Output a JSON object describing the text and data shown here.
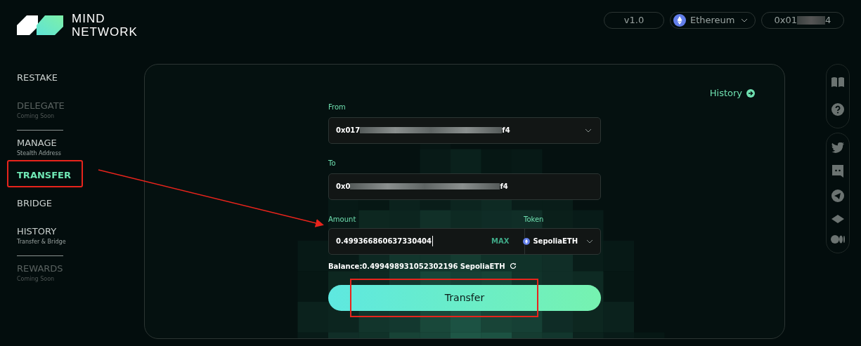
{
  "logo": {
    "line_1": "MIND",
    "line_2": "NETWORK"
  },
  "header": {
    "version": "v1.0",
    "network": "Ethereum",
    "account_start": "0x01",
    "account_end": "4"
  },
  "sidebar": {
    "items": [
      {
        "kind": "link",
        "label": "RESTAKE",
        "disabled": false,
        "selected": false
      },
      {
        "kind": "link",
        "label": "DELEGATE",
        "subtitle": "Coming Soon",
        "disabled": true,
        "selected": false
      },
      {
        "kind": "divider"
      },
      {
        "kind": "link",
        "label": "MANAGE",
        "subtitle": "Stealth Address",
        "disabled": false,
        "selected": false
      },
      {
        "kind": "link",
        "label": "TRANSFER",
        "disabled": false,
        "selected": true
      },
      {
        "kind": "link",
        "label": "BRIDGE",
        "disabled": false,
        "selected": false
      },
      {
        "kind": "link",
        "label": "HISTORY",
        "subtitle": "Transfer & Bridge",
        "disabled": false,
        "selected": false
      },
      {
        "kind": "divider"
      },
      {
        "kind": "link",
        "label": "REWARDS",
        "subtitle": "Coming Soon",
        "disabled": true,
        "selected": false
      }
    ]
  },
  "history_link": "History",
  "form": {
    "from_label": "From",
    "from_start": "0x017",
    "from_end": "f4",
    "to_label": "To",
    "to_start": "0x0",
    "to_end": "f4",
    "amount_label": "Amount",
    "amount_value": "0.499366860637330404",
    "max_label": "MAX",
    "token_label": "Token",
    "token": "SepoliaETH",
    "balance": "Balance:0.499498931052302196 SepoliaETH",
    "submit": "Transfer"
  }
}
